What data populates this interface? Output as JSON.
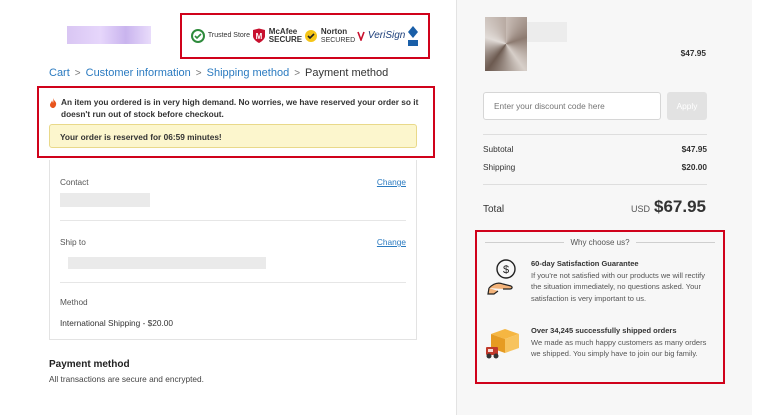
{
  "badges": [
    {
      "icon": "trusted-store-icon",
      "title": "",
      "line": "Trusted Store"
    },
    {
      "icon": "mcafee-shield-icon",
      "title": "McAfee",
      "line": "SECURE"
    },
    {
      "icon": "norton-check-icon",
      "title": "Norton",
      "line": "SECURED"
    },
    {
      "icon": "verisign-icon",
      "title": "VeriSign",
      "line": ""
    },
    {
      "icon": "bbb-icon",
      "title": "",
      "line": ""
    }
  ],
  "breadcrumb": {
    "cart": "Cart",
    "customer": "Customer information",
    "shipping": "Shipping method",
    "payment": "Payment method",
    "separator": ">"
  },
  "alert": {
    "message": "An item you ordered is in very high demand. No worries, we have reserved your order so it doesn't run out of stock before checkout.",
    "reserve_text": "Your order is reserved for 06:59 minutes!"
  },
  "info": {
    "contact_label": "Contact",
    "ship_to_label": "Ship to",
    "change_label": "Change",
    "method_label": "Method",
    "method_value": "International Shipping - $20.00"
  },
  "payment": {
    "title": "Payment method",
    "subtitle": "All transactions are secure and encrypted."
  },
  "summary": {
    "item_price": "$47.95",
    "discount_placeholder": "Enter your discount code here",
    "apply_label": "Apply",
    "subtotal_label": "Subtotal",
    "subtotal_value": "$47.95",
    "shipping_label": "Shipping",
    "shipping_value": "$20.00",
    "total_label": "Total",
    "currency": "USD",
    "total_value": "$67.95"
  },
  "why": {
    "heading": "Why choose us?",
    "items": [
      {
        "icon": "money-hand-icon",
        "title": "60-day Satisfaction Guarantee",
        "text": "If you're not satisfied with our products we will rectify the situation immediately, no questions asked. Your satisfaction is very important to us."
      },
      {
        "icon": "delivery-truck-icon",
        "title": "Over 34,245 successfully shipped orders",
        "text": "We made as much happy customers as many orders we shipped. You simply have to join our big family."
      }
    ]
  },
  "colors": {
    "link": "#2a7ac0",
    "highlight_border": "#d0021b",
    "reserve_bg": "#fcf6cd"
  }
}
